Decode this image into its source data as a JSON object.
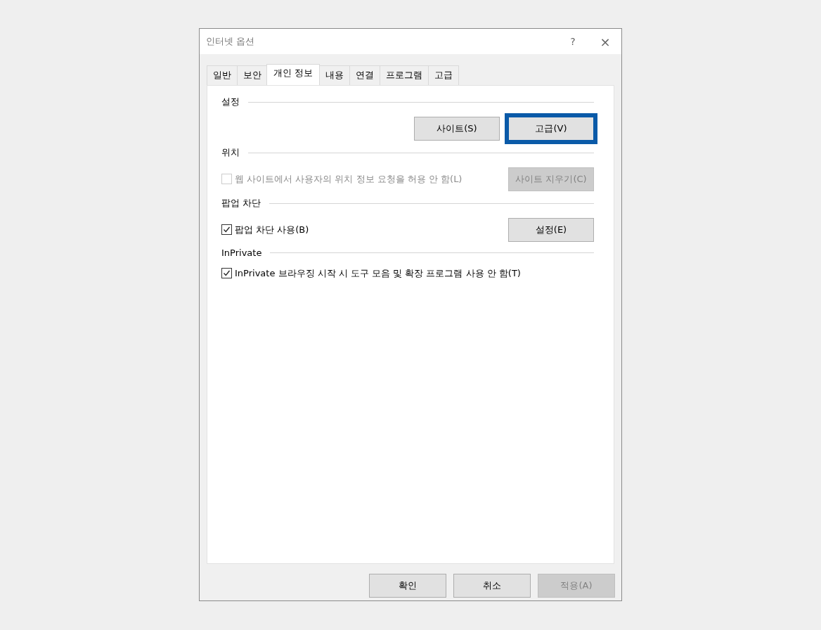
{
  "window": {
    "title": "인터넷 옵션",
    "help": "?",
    "close": "×"
  },
  "tabs": [
    {
      "label": "일반",
      "selected": false
    },
    {
      "label": "보안",
      "selected": false
    },
    {
      "label": "개인 정보",
      "selected": true
    },
    {
      "label": "내용",
      "selected": false
    },
    {
      "label": "연결",
      "selected": false
    },
    {
      "label": "프로그램",
      "selected": false
    },
    {
      "label": "고급",
      "selected": false
    }
  ],
  "sections": [
    {
      "title": "설정",
      "rows": [
        {
          "kind": "buttons",
          "buttons": [
            {
              "label": "사이트(S)",
              "disabled": false,
              "highlighted": false
            },
            {
              "label": "고급(V)",
              "disabled": false,
              "highlighted": true
            }
          ]
        }
      ]
    },
    {
      "title": "위치",
      "rows": [
        {
          "kind": "check",
          "label": "웹 사이트에서 사용자의 위치 정보 요청을 허용 안 함(L)",
          "checked": false,
          "disabled": true,
          "button": {
            "label": "사이트 지우기(C)",
            "disabled": true,
            "highlighted": false
          }
        }
      ]
    },
    {
      "title": "팝업 차단",
      "rows": [
        {
          "kind": "check",
          "label": "팝업 차단 사용(B)",
          "checked": true,
          "disabled": false,
          "button": {
            "label": "설정(E)",
            "disabled": false,
            "highlighted": false
          }
        }
      ]
    },
    {
      "title": "InPrivate",
      "rows": [
        {
          "kind": "check",
          "label": "InPrivate 브라우징 시작 시 도구 모음 및 확장 프로그램 사용 안 함(T)",
          "checked": true,
          "disabled": false
        }
      ]
    }
  ],
  "footer_buttons": [
    {
      "label": "확인",
      "disabled": false,
      "highlighted": false
    },
    {
      "label": "취소",
      "disabled": false,
      "highlighted": false
    },
    {
      "label": "적용(A)",
      "disabled": true,
      "highlighted": false
    }
  ]
}
